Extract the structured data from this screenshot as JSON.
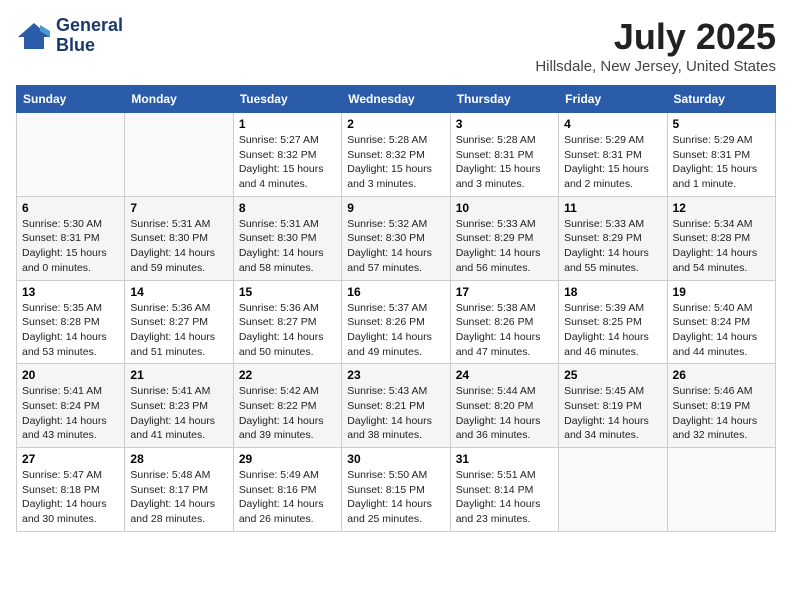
{
  "header": {
    "logo_line1": "General",
    "logo_line2": "Blue",
    "month": "July 2025",
    "location": "Hillsdale, New Jersey, United States"
  },
  "weekdays": [
    "Sunday",
    "Monday",
    "Tuesday",
    "Wednesday",
    "Thursday",
    "Friday",
    "Saturday"
  ],
  "weeks": [
    [
      {
        "day": "",
        "text": ""
      },
      {
        "day": "",
        "text": ""
      },
      {
        "day": "1",
        "text": "Sunrise: 5:27 AM\nSunset: 8:32 PM\nDaylight: 15 hours\nand 4 minutes."
      },
      {
        "day": "2",
        "text": "Sunrise: 5:28 AM\nSunset: 8:32 PM\nDaylight: 15 hours\nand 3 minutes."
      },
      {
        "day": "3",
        "text": "Sunrise: 5:28 AM\nSunset: 8:31 PM\nDaylight: 15 hours\nand 3 minutes."
      },
      {
        "day": "4",
        "text": "Sunrise: 5:29 AM\nSunset: 8:31 PM\nDaylight: 15 hours\nand 2 minutes."
      },
      {
        "day": "5",
        "text": "Sunrise: 5:29 AM\nSunset: 8:31 PM\nDaylight: 15 hours\nand 1 minute."
      }
    ],
    [
      {
        "day": "6",
        "text": "Sunrise: 5:30 AM\nSunset: 8:31 PM\nDaylight: 15 hours\nand 0 minutes."
      },
      {
        "day": "7",
        "text": "Sunrise: 5:31 AM\nSunset: 8:30 PM\nDaylight: 14 hours\nand 59 minutes."
      },
      {
        "day": "8",
        "text": "Sunrise: 5:31 AM\nSunset: 8:30 PM\nDaylight: 14 hours\nand 58 minutes."
      },
      {
        "day": "9",
        "text": "Sunrise: 5:32 AM\nSunset: 8:30 PM\nDaylight: 14 hours\nand 57 minutes."
      },
      {
        "day": "10",
        "text": "Sunrise: 5:33 AM\nSunset: 8:29 PM\nDaylight: 14 hours\nand 56 minutes."
      },
      {
        "day": "11",
        "text": "Sunrise: 5:33 AM\nSunset: 8:29 PM\nDaylight: 14 hours\nand 55 minutes."
      },
      {
        "day": "12",
        "text": "Sunrise: 5:34 AM\nSunset: 8:28 PM\nDaylight: 14 hours\nand 54 minutes."
      }
    ],
    [
      {
        "day": "13",
        "text": "Sunrise: 5:35 AM\nSunset: 8:28 PM\nDaylight: 14 hours\nand 53 minutes."
      },
      {
        "day": "14",
        "text": "Sunrise: 5:36 AM\nSunset: 8:27 PM\nDaylight: 14 hours\nand 51 minutes."
      },
      {
        "day": "15",
        "text": "Sunrise: 5:36 AM\nSunset: 8:27 PM\nDaylight: 14 hours\nand 50 minutes."
      },
      {
        "day": "16",
        "text": "Sunrise: 5:37 AM\nSunset: 8:26 PM\nDaylight: 14 hours\nand 49 minutes."
      },
      {
        "day": "17",
        "text": "Sunrise: 5:38 AM\nSunset: 8:26 PM\nDaylight: 14 hours\nand 47 minutes."
      },
      {
        "day": "18",
        "text": "Sunrise: 5:39 AM\nSunset: 8:25 PM\nDaylight: 14 hours\nand 46 minutes."
      },
      {
        "day": "19",
        "text": "Sunrise: 5:40 AM\nSunset: 8:24 PM\nDaylight: 14 hours\nand 44 minutes."
      }
    ],
    [
      {
        "day": "20",
        "text": "Sunrise: 5:41 AM\nSunset: 8:24 PM\nDaylight: 14 hours\nand 43 minutes."
      },
      {
        "day": "21",
        "text": "Sunrise: 5:41 AM\nSunset: 8:23 PM\nDaylight: 14 hours\nand 41 minutes."
      },
      {
        "day": "22",
        "text": "Sunrise: 5:42 AM\nSunset: 8:22 PM\nDaylight: 14 hours\nand 39 minutes."
      },
      {
        "day": "23",
        "text": "Sunrise: 5:43 AM\nSunset: 8:21 PM\nDaylight: 14 hours\nand 38 minutes."
      },
      {
        "day": "24",
        "text": "Sunrise: 5:44 AM\nSunset: 8:20 PM\nDaylight: 14 hours\nand 36 minutes."
      },
      {
        "day": "25",
        "text": "Sunrise: 5:45 AM\nSunset: 8:19 PM\nDaylight: 14 hours\nand 34 minutes."
      },
      {
        "day": "26",
        "text": "Sunrise: 5:46 AM\nSunset: 8:19 PM\nDaylight: 14 hours\nand 32 minutes."
      }
    ],
    [
      {
        "day": "27",
        "text": "Sunrise: 5:47 AM\nSunset: 8:18 PM\nDaylight: 14 hours\nand 30 minutes."
      },
      {
        "day": "28",
        "text": "Sunrise: 5:48 AM\nSunset: 8:17 PM\nDaylight: 14 hours\nand 28 minutes."
      },
      {
        "day": "29",
        "text": "Sunrise: 5:49 AM\nSunset: 8:16 PM\nDaylight: 14 hours\nand 26 minutes."
      },
      {
        "day": "30",
        "text": "Sunrise: 5:50 AM\nSunset: 8:15 PM\nDaylight: 14 hours\nand 25 minutes."
      },
      {
        "day": "31",
        "text": "Sunrise: 5:51 AM\nSunset: 8:14 PM\nDaylight: 14 hours\nand 23 minutes."
      },
      {
        "day": "",
        "text": ""
      },
      {
        "day": "",
        "text": ""
      }
    ]
  ]
}
